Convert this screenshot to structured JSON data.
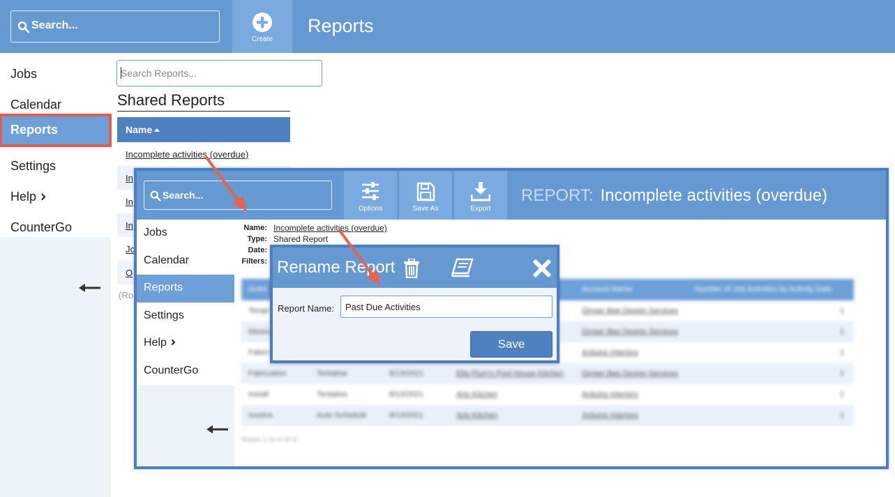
{
  "header": {
    "search_placeholder": "Search...",
    "create_label": "Create",
    "page_title": "Reports"
  },
  "sidebar": {
    "items": [
      {
        "label": "Jobs"
      },
      {
        "label": "Calendar"
      },
      {
        "label": "Reports",
        "active": true
      },
      {
        "label": "Settings"
      },
      {
        "label": "Help"
      },
      {
        "label": "CounterGo"
      }
    ]
  },
  "main": {
    "search_placeholder": "Search Reports...",
    "section_title": "Shared Reports",
    "column_header": "Name",
    "rows": [
      "Incomplete activities (overdue)",
      "In",
      "In",
      "In",
      "Jo",
      "O"
    ],
    "rows_footer": "(Ro"
  },
  "overlay": {
    "search_placeholder": "Search...",
    "tools": [
      {
        "label": "Options",
        "icon": "sliders-icon"
      },
      {
        "label": "Save As",
        "icon": "floppy-icon"
      },
      {
        "label": "Export",
        "icon": "download-icon"
      }
    ],
    "title_prefix": "REPORT:",
    "title": "Incomplete activities (overdue)",
    "sidebar_items": [
      "Jobs",
      "Calendar",
      "Reports",
      "Settings",
      "Help",
      "CounterGo"
    ],
    "meta": {
      "name_label": "Name:",
      "name_value": "Incomplete activities (overdue)",
      "type_label": "Type:",
      "type_value": "Shared Report",
      "date_label": "Date:",
      "filters_label": "Filters:"
    },
    "table": {
      "headers": [
        "Activi",
        "",
        "",
        "",
        "Account Name",
        "Number of Job Activities by Activity Date"
      ],
      "rows": [
        [
          "Templ",
          "",
          "",
          "",
          "Ginger Bee Design Services",
          "1"
        ],
        [
          "Measu",
          "",
          "",
          "",
          "Ginger Bee Design Services",
          "1"
        ],
        [
          "Fabric",
          "",
          "",
          "",
          "Arduino Interiors",
          "1"
        ],
        [
          "Fabrication",
          "Tentative",
          "8/13/2021",
          "Ella Plum's Pool House Kitchen",
          "Ginger Bee Design Services",
          "1"
        ],
        [
          "Install",
          "Tentative",
          "8/13/2021",
          "Arts Kitchen",
          "Arduino Interiors",
          "1"
        ],
        [
          "Invoice",
          "Auto Schedule",
          "8/13/2021",
          "Arts Kitchen",
          "Arduino Interiors",
          "1"
        ]
      ],
      "footer": "Rows 1 to 6 of 6"
    }
  },
  "dialog": {
    "title": "Rename Report",
    "label": "Report Name:",
    "value": "Past Due Activities",
    "save_label": "Save"
  },
  "colors": {
    "header_blue": "#6699d2",
    "active_blue": "#6e9fd8",
    "button_blue": "#4f80bf",
    "highlight_red": "#e06050"
  }
}
